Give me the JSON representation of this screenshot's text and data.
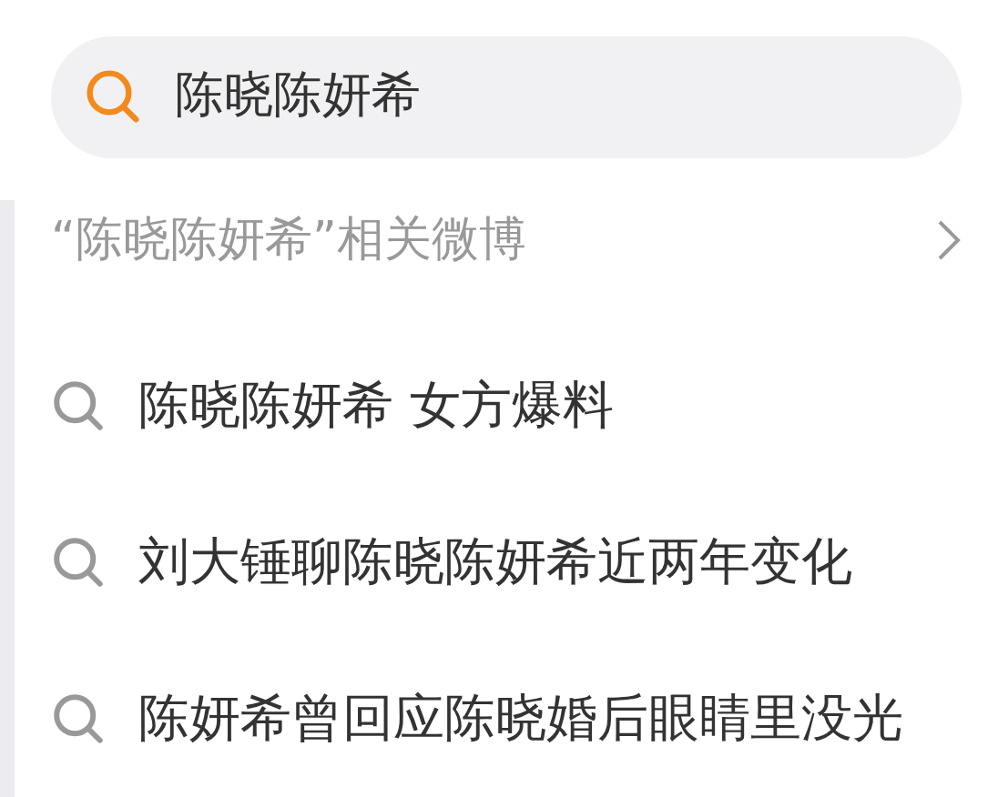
{
  "search": {
    "value": "陈晓陈妍希"
  },
  "related": {
    "label": "“陈晓陈妍希”相关微博"
  },
  "suggestions": [
    {
      "text": "陈晓陈妍希 女方爆料"
    },
    {
      "text": "刘大锤聊陈晓陈妍希近两年变化"
    },
    {
      "text": "陈妍希曾回应陈晓婚后眼睛里没光"
    }
  ]
}
